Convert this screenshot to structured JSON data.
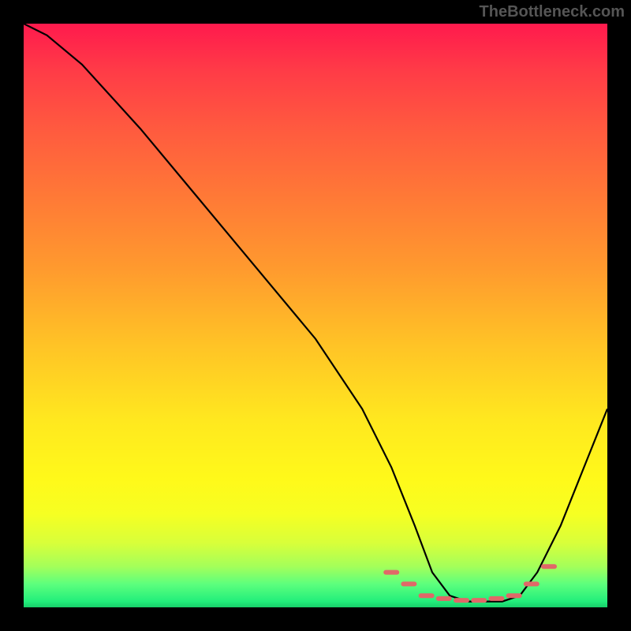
{
  "watermark": "TheBottleneck.com",
  "chart_data": {
    "type": "line",
    "title": "",
    "xlabel": "",
    "ylabel": "",
    "xlim": [
      0,
      100
    ],
    "ylim": [
      0,
      100
    ],
    "series": [
      {
        "name": "bottleneck-curve",
        "x": [
          0,
          4,
          10,
          20,
          30,
          40,
          50,
          58,
          63,
          67,
          70,
          73,
          76,
          79,
          82,
          85,
          88,
          92,
          96,
          100
        ],
        "values": [
          100,
          98,
          93,
          82,
          70,
          58,
          46,
          34,
          24,
          14,
          6,
          2,
          1,
          1,
          1,
          2,
          6,
          14,
          24,
          34
        ]
      }
    ],
    "markers": {
      "name": "highlight-band",
      "style": "dashed",
      "color": "#e57373",
      "x": [
        63,
        66,
        69,
        72,
        75,
        78,
        81,
        84,
        87,
        90
      ],
      "values": [
        6,
        4,
        2,
        1.5,
        1.2,
        1.2,
        1.5,
        2,
        4,
        7
      ]
    },
    "background_gradient": {
      "top": "#ff1a4d",
      "mid": "#ffe81f",
      "bottom": "#18d06a"
    }
  }
}
